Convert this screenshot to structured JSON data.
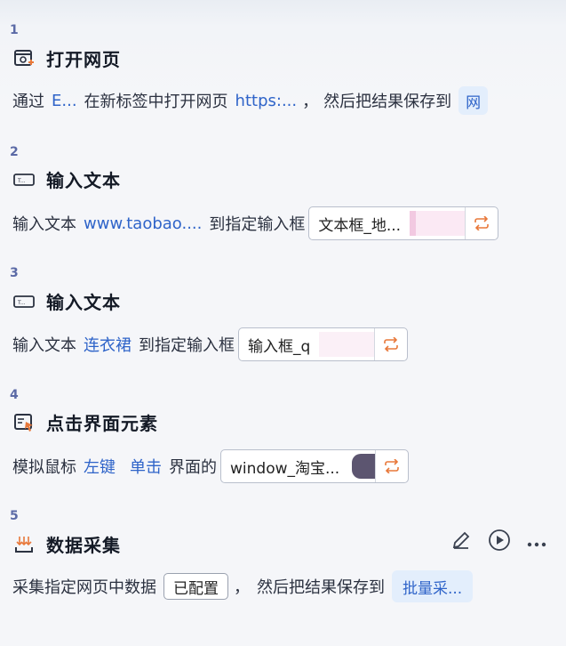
{
  "steps": [
    {
      "num": "1",
      "icon": "open-webpage-icon",
      "title": "打开网页",
      "parts": {
        "a": "通过",
        "b": "E...",
        "c": "在新标签中打开网页",
        "d": "https:...",
        "e": "，",
        "f": "然后把结果保存到",
        "g": "网"
      }
    },
    {
      "num": "2",
      "icon": "input-text-icon",
      "title": "输入文本",
      "parts": {
        "a": "输入文本",
        "b": "www.taobao....",
        "c": "到指定输入框",
        "box": "文本框_地..."
      }
    },
    {
      "num": "3",
      "icon": "input-text-icon",
      "title": "输入文本",
      "parts": {
        "a": "输入文本",
        "b": "连衣裙",
        "c": "到指定输入框",
        "box": "输入框_q"
      }
    },
    {
      "num": "4",
      "icon": "click-element-icon",
      "title": "点击界面元素",
      "parts": {
        "a": "模拟鼠标",
        "b": "左键",
        "c": "单击",
        "d": "界面的",
        "box": "window_淘宝..."
      }
    },
    {
      "num": "5",
      "icon": "data-collect-icon",
      "title": "数据采集",
      "parts": {
        "a": "采集指定网页中数据",
        "tag": "已配置",
        "b": "，",
        "c": "然后把结果保存到",
        "chip": "批量采..."
      }
    }
  ]
}
